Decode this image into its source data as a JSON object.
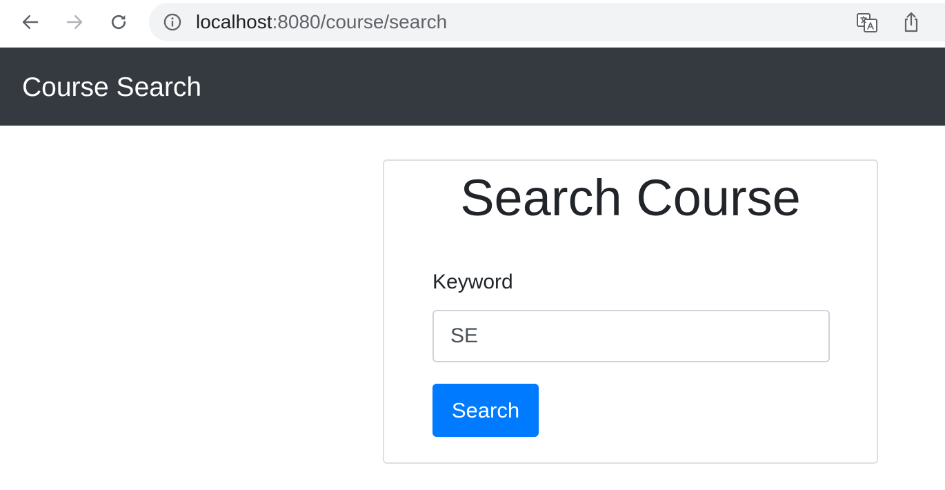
{
  "browser": {
    "url_host": "localhost",
    "url_rest": ":8080/course/search",
    "icons": {
      "back": "arrow-left-icon",
      "forward": "arrow-right-icon",
      "reload": "reload-icon",
      "info": "info-icon",
      "translate": "translate-icon",
      "share": "share-icon"
    }
  },
  "navbar": {
    "brand": "Course Search",
    "background": "#343a40"
  },
  "card": {
    "title": "Search Course",
    "keyword_label": "Keyword",
    "keyword_value": "SE",
    "search_button_label": "Search",
    "button_color": "#007bff"
  }
}
